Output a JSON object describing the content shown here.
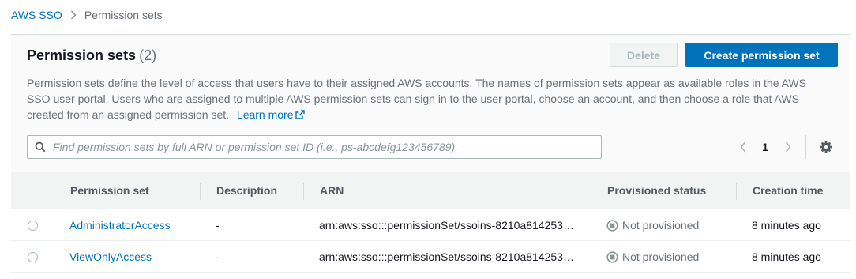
{
  "breadcrumb": {
    "root": "AWS SSO",
    "current": "Permission sets"
  },
  "header": {
    "title": "Permission sets",
    "count": "(2)",
    "delete_label": "Delete",
    "create_label": "Create permission set",
    "description": "Permission sets define the level of access that users have to their assigned AWS accounts. The names of permission sets appear as available roles in the AWS SSO user portal. Users who are assigned to multiple AWS permission sets can sign in to the user portal, choose an account, and then choose a role that AWS created from an assigned permission set.",
    "learn_more": "Learn more"
  },
  "search": {
    "placeholder": "Find permission sets by full ARN or permission set ID (i.e., ps-abcdefg123456789).",
    "value": ""
  },
  "pagination": {
    "current_page": "1"
  },
  "table": {
    "columns": [
      "Permission set",
      "Description",
      "ARN",
      "Provisioned status",
      "Creation time"
    ],
    "rows": [
      {
        "name": "AdministratorAccess",
        "description": "-",
        "arn": "arn:aws:sso:::permissionSet/ssoins-8210a814253…",
        "status": "Not provisioned",
        "created": "8 minutes ago"
      },
      {
        "name": "ViewOnlyAccess",
        "description": "-",
        "arn": "arn:aws:sso:::permissionSet/ssoins-8210a814253…",
        "status": "Not provisioned",
        "created": "8 minutes ago"
      }
    ]
  },
  "icons": {
    "breadcrumb_separator": "chevron-right-icon",
    "external_link": "external-link-icon",
    "search": "search-icon",
    "prev": "chevron-left-icon",
    "next": "chevron-right-icon",
    "settings": "gear-icon",
    "status": "not-provisioned-icon"
  },
  "colors": {
    "link": "#0073bb",
    "primary_button": "#0073bb",
    "muted_text": "#687078",
    "header_bg": "#fafafa",
    "table_header_bg": "#f2f3f3"
  }
}
